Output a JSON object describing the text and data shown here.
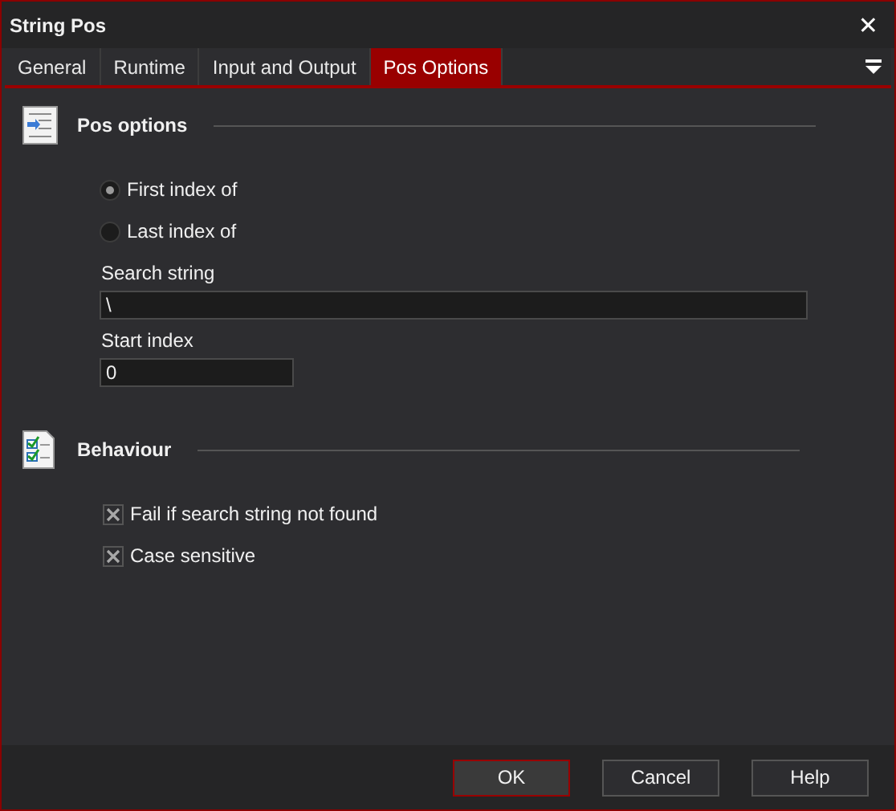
{
  "window": {
    "title": "String Pos",
    "close": "✕"
  },
  "tabs": [
    {
      "label": "General",
      "selected": false
    },
    {
      "label": "Runtime",
      "selected": false
    },
    {
      "label": "Input and Output",
      "selected": false
    },
    {
      "label": "Pos Options",
      "selected": true
    }
  ],
  "pos_options": {
    "heading": "Pos options",
    "radios": [
      {
        "label": "First index of",
        "selected": true
      },
      {
        "label": "Last index of",
        "selected": false
      }
    ],
    "search_string": {
      "label": "Search string",
      "value": "\\"
    },
    "start_index": {
      "label": "Start index",
      "value": "0"
    }
  },
  "behaviour": {
    "heading": "Behaviour",
    "checkboxes": [
      {
        "label": "Fail if search string not found",
        "checked": true
      },
      {
        "label": "Case sensitive",
        "checked": true
      }
    ]
  },
  "buttons": [
    {
      "label": "OK",
      "default": true
    },
    {
      "label": "Cancel",
      "default": false
    },
    {
      "label": "Help",
      "default": false
    }
  ]
}
